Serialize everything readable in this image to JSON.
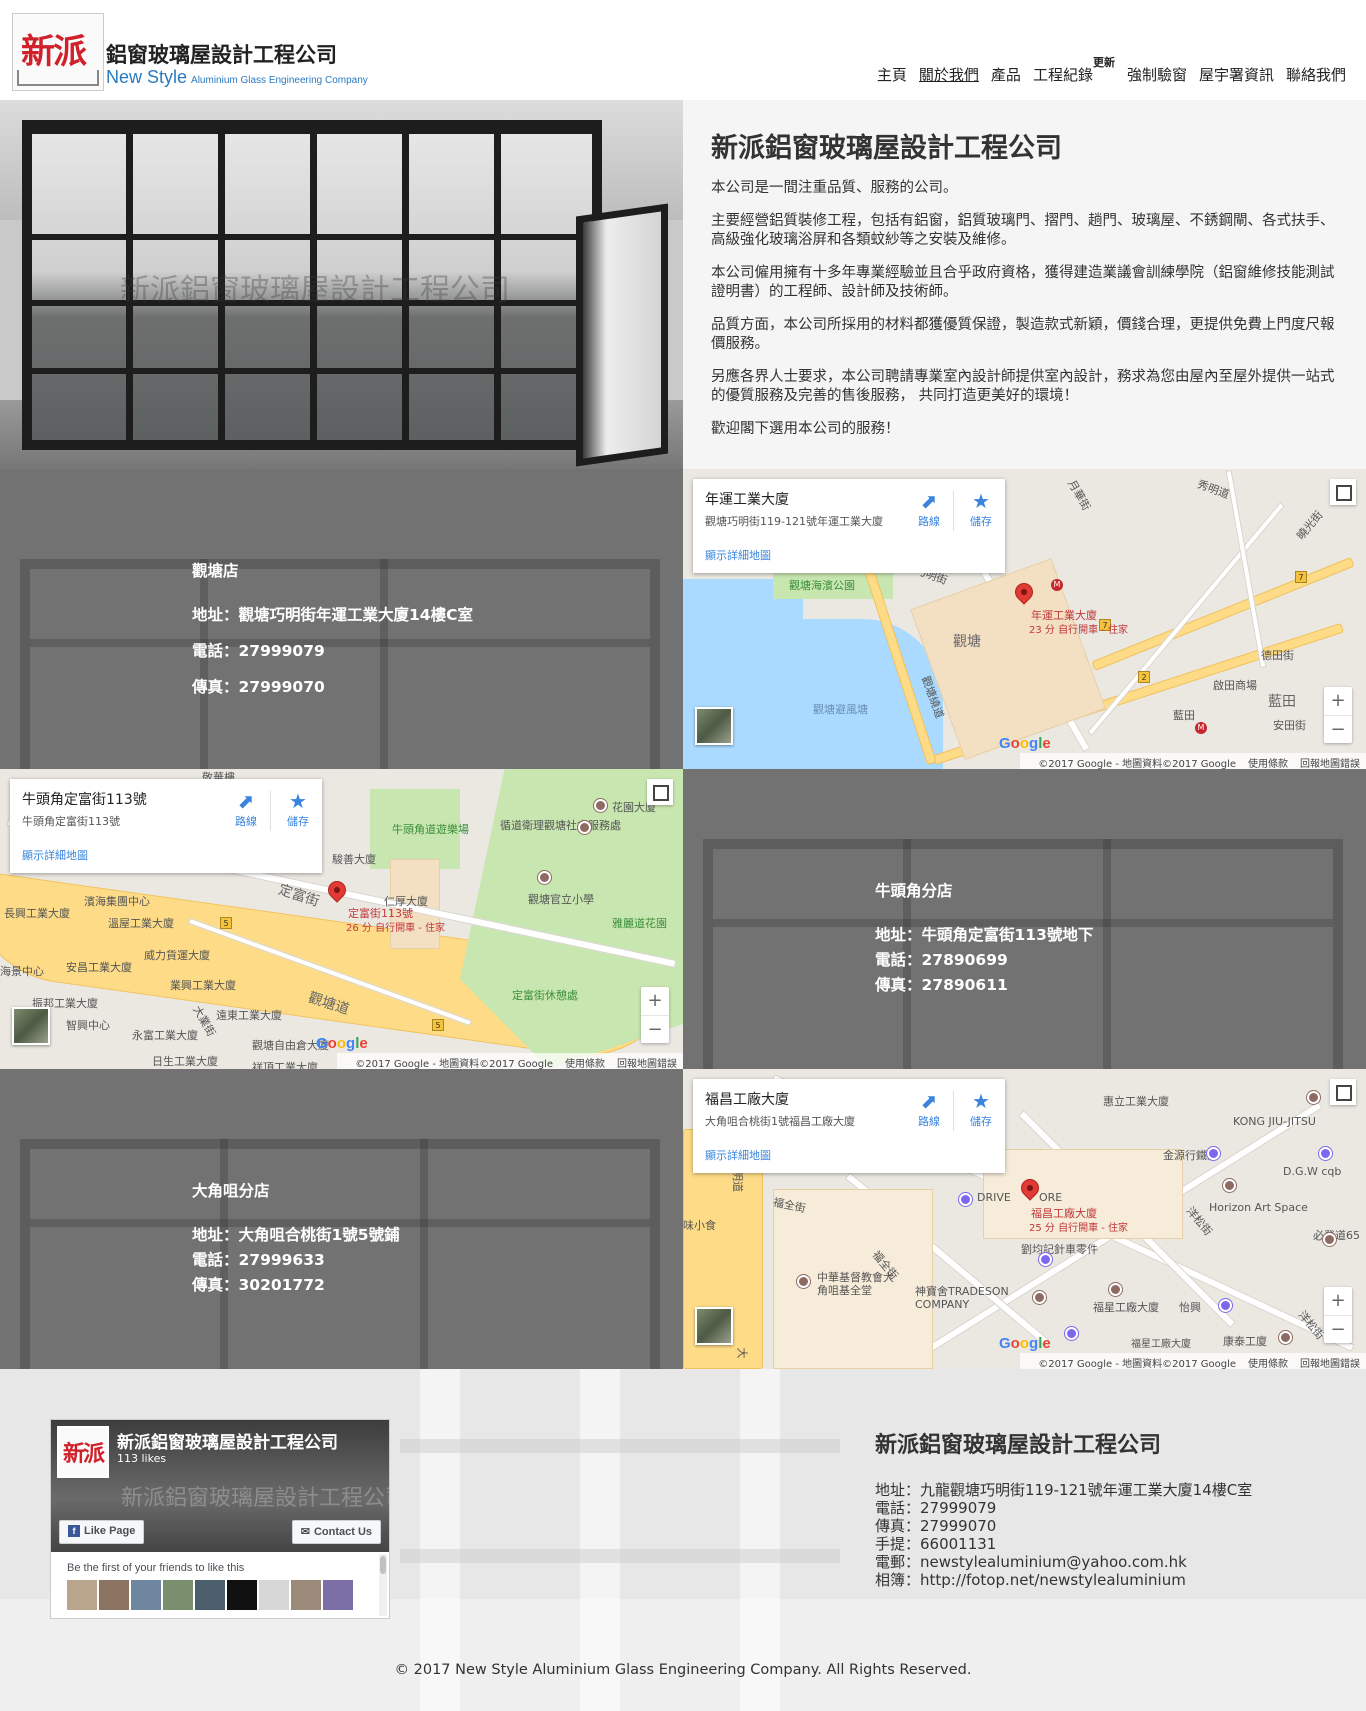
{
  "header": {
    "logo_mark": "新派",
    "logo_zh": "鋁窗玻璃屋設計工程公司",
    "logo_en_big": "New Style",
    "logo_en_small": "Aluminium Glass Engineering Company"
  },
  "nav": {
    "items": [
      {
        "label": "主頁"
      },
      {
        "label": "關於我們",
        "active": true
      },
      {
        "label": "產品"
      },
      {
        "label": "工程紀錄",
        "badge": "更新"
      },
      {
        "label": "強制驗窗"
      },
      {
        "label": "屋宇署資訊"
      },
      {
        "label": "聯絡我們"
      }
    ]
  },
  "hero": {
    "watermark": "新派鋁窗玻璃屋設計工程公司",
    "title": "新派鋁窗玻璃屋設計工程公司",
    "paragraphs": [
      "本公司是一間注重品質、服務的公司。",
      "主要經營鋁質裝修工程，包括有鋁窗，鋁質玻璃門、摺門、趟門、玻璃屋、不銹鋼閘、各式扶手、高級強化玻璃浴屏和各類蚊紗等之安裝及維修。",
      "本公司僱用擁有十多年專業經驗並且合乎政府資格，獲得建造業議會訓練學院（鋁窗維修技能測試證明書）的工程師、設計師及技術師。",
      "品質方面，本公司所採用的材料都獲優質保證，製造款式新穎，價錢合理，更提供免費上門度尺報價服務。",
      "另應各界人士要求，本公司聘請專業室內設計師提供室內設計，務求為您由屋內至屋外提供一站式的優質服務及完善的售後服務， 共同打造更美好的環境！",
      "歡迎閣下選用本公司的服務！"
    ]
  },
  "stores": [
    {
      "name": "觀塘店",
      "address": "地址：觀塘巧明街年運工業大廈14樓C室",
      "phone": "電話：27999079",
      "fax": "傳真：27999070"
    },
    {
      "name": "牛頭角分店",
      "address": "地址：牛頭角定富街113號地下",
      "phone": "電話：27890699",
      "fax": "傳真：27890611"
    },
    {
      "name": "大角咀分店",
      "address": "地址：大角咀合桃街1號5號鋪",
      "phone": "電話：27999633",
      "fax": "傳真：30201772"
    }
  ],
  "map_common": {
    "directions": "路線",
    "save": "儲存",
    "larger_map": "顯示詳細地圖",
    "zoom_in": "+",
    "zoom_out": "−",
    "attribution": "©2017 Google - 地圖資料©2017 Google",
    "terms": "使用條款",
    "report": "回報地圖錯誤",
    "google": "Google"
  },
  "maps": [
    {
      "card_title": "年運工業大廈",
      "card_address": "觀塘巧明街119-121號年運工業大廈",
      "pin_label": "年運工業大廈",
      "pin_sub": "23 分 自行開車 - 住家",
      "labels": [
        "觀塘海濱公園",
        "觀塘",
        "觀塘避風塘",
        "觀塘繞道",
        "德田街",
        "啟田商場",
        "藍田",
        "安田街",
        "巧明街",
        "秀明道",
        "曉光街",
        "月華街",
        "藍田"
      ]
    },
    {
      "card_title": "牛頭角定富街113號",
      "card_address": "牛頭角定富街113號",
      "pin_label": "定富街113號",
      "pin_sub": "26 分 自行開車 - 住家",
      "labels": [
        "牛頭角道遊樂場",
        "循道衛理觀塘社會服務處",
        "花園大廈",
        "觀塘官立小學",
        "雅麗道花園",
        "定富街休憩處",
        "觀塘道",
        "定富街",
        "仁厚大廈",
        "濱海集團中心",
        "長興工業大廈",
        "溫屋工業大廈",
        "威力貨運大廈",
        "海景中心",
        "安昌工業大廈",
        "業興工業大廈",
        "振邦工業大廈",
        "智興中心",
        "永富工業大廈",
        "遠東工業大廈",
        "觀塘自由倉大廈",
        "祥頂工業大廈",
        "日生工業大廈",
        "大業街",
        "敬華樓",
        "駿善大廈"
      ]
    },
    {
      "card_title": "福昌工廠大廈",
      "card_address": "大角咀合桃街1號福昌工廠大廈",
      "pin_label": "福昌工廠大廈",
      "pin_sub": "25 分 自行開車 - 住家",
      "labels": [
        "福全街",
        "福全街",
        "洋松街",
        "洋松街",
        "惠立工業大廈",
        "KONG JIU-JITSU",
        "金源行鐵倉",
        "D.G.W cqb",
        "Horizon Art Space",
        "必發道65",
        "DRIVE",
        "ORE",
        "劉均記針車零件",
        "中華基督教會大角咀基全堂",
        "神寶舍TRADESON COMPANY",
        "福星工廠大廈",
        "怡興",
        "福星工廠大廈",
        "康泰工廈",
        "味小食",
        "明道",
        "大"
      ]
    }
  ],
  "footer": {
    "fb_name": "新派鋁窗玻璃屋設計工程公司",
    "fb_likes": "113 likes",
    "fb_like_btn": "Like Page",
    "fb_contact_btn": "Contact Us",
    "fb_friends": "Be the first of your friends to like this",
    "fb_watermark": "新派鋁窗玻璃屋設計工程公司",
    "contact_title": "新派鋁窗玻璃屋設計工程公司",
    "contact_lines": [
      "地址：九龍觀塘巧明街119-121號年運工業大廈14樓C室",
      "電話：27999079",
      "傳真：27999070",
      "手提：66001131",
      "電郵：newstylealuminium@yahoo.com.hk",
      "相簿：http://fotop.net/newstylealuminium"
    ],
    "copyright": "© 2017 New Style Aluminium Glass Engineering Company. All Rights Reserved."
  }
}
